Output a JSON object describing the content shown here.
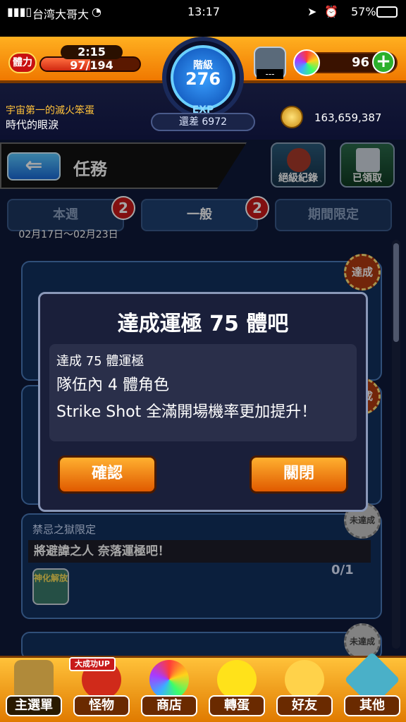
{
  "status_bar": {
    "carrier": "台湾大哥大",
    "time": "13:17",
    "battery": "57%"
  },
  "header": {
    "stamina_label": "體力",
    "stamina_timer": "2:15",
    "stamina_value": "97/194",
    "stamina_fraction": 0.5,
    "rank_label": "階級",
    "rank": "276",
    "exp_label": "EXP",
    "exp_diff": "還差 6972",
    "gem_box_label": "---",
    "orb_count": "96",
    "orb_plus": "+",
    "user_title": "宇宙第一的滅火笨蛋",
    "user_name": "時代的眼淚",
    "gold": "163,659,387"
  },
  "page": {
    "back": "⇐",
    "title": "任務",
    "ultimate_label": "絕級紀錄",
    "received_label": "已領取"
  },
  "tabs": [
    {
      "label": "本週",
      "badge": "2"
    },
    {
      "label": "一般",
      "badge": "2"
    },
    {
      "label": "期間限定"
    }
  ],
  "date_range": "02月17日～02月23日",
  "cards": {
    "card3_header": "禁忌之獄限定",
    "card3_body": "將避諱之人 奈落運極吧！",
    "card3_progress": "0/1",
    "card3_icon": "神化解放",
    "stamp_done": "達成",
    "stamp_not": "未達成"
  },
  "modal": {
    "title": "達成運極 75 體吧",
    "line1": "達成 75 體運極",
    "line2": "隊伍內 4 體角色",
    "line3": "Strike Shot 全滿開場機率更加提升！",
    "confirm": "確認",
    "close": "關閉"
  },
  "nav": {
    "main": "主選單",
    "monster": "怪物",
    "monster_tag": "大成功UP",
    "shop": "商店",
    "gacha": "轉蛋",
    "friends": "好友",
    "other": "其他"
  }
}
